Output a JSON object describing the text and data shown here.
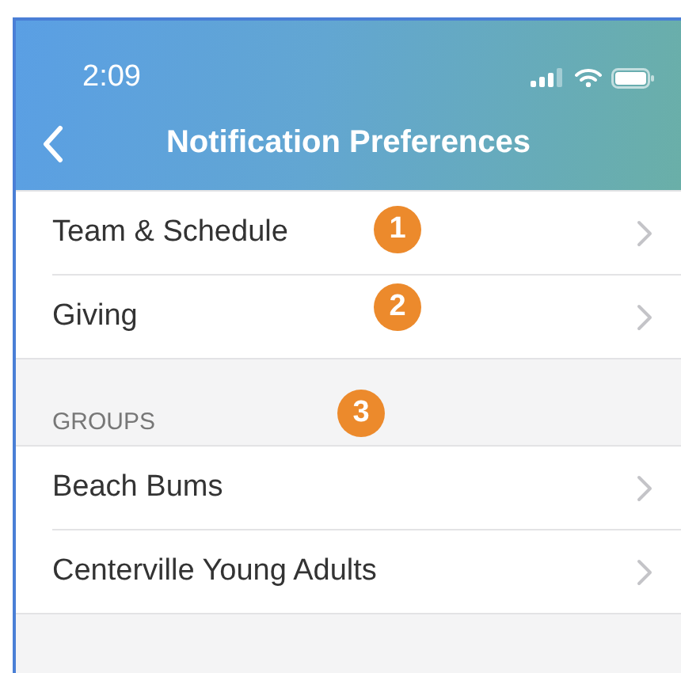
{
  "status_bar": {
    "time": "2:09"
  },
  "nav": {
    "title": "Notification Preferences"
  },
  "sections": [
    {
      "items": [
        {
          "label": "Team & Schedule",
          "badge": "1"
        },
        {
          "label": "Giving",
          "badge": "2"
        }
      ]
    },
    {
      "header": "GROUPS",
      "header_badge": "3",
      "items": [
        {
          "label": "Beach Bums"
        },
        {
          "label": "Centerville Young Adults"
        }
      ]
    }
  ]
}
